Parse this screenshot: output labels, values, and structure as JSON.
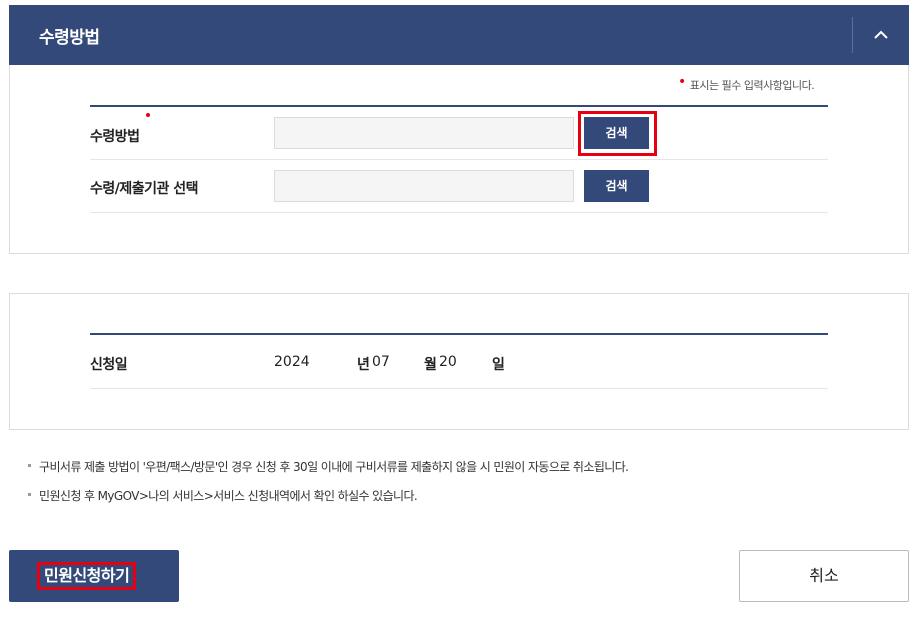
{
  "section": {
    "title": "수령방법",
    "required_note": "표시는 필수 입력사항입니다."
  },
  "fields": [
    {
      "label": "수령방법",
      "value": "",
      "button": "검색"
    },
    {
      "label": "수령/제출기관 선택",
      "value": "",
      "button": "검색"
    }
  ],
  "date": {
    "label": "신청일",
    "year": "2024",
    "year_unit": "년",
    "month": "07",
    "month_unit": "월",
    "day": "20",
    "day_unit": "일"
  },
  "notes": [
    "구비서류 제출 방법이 '우편/팩스/방문'인 경우 신청 후 30일 이내에 구비서류를 제출하지 않을 시 민원이 자동으로 취소됩니다.",
    "민원신청 후 MyGOV>나의 서비스>서비스 신청내역에서 확인 하실수 있습니다."
  ],
  "actions": {
    "submit": "민원신청하기",
    "cancel": "취소"
  },
  "colors": {
    "primary": "#33497a",
    "required": "#e60012",
    "highlight": "#e60012"
  },
  "icons": {
    "collapse": "chevron-up-icon"
  }
}
